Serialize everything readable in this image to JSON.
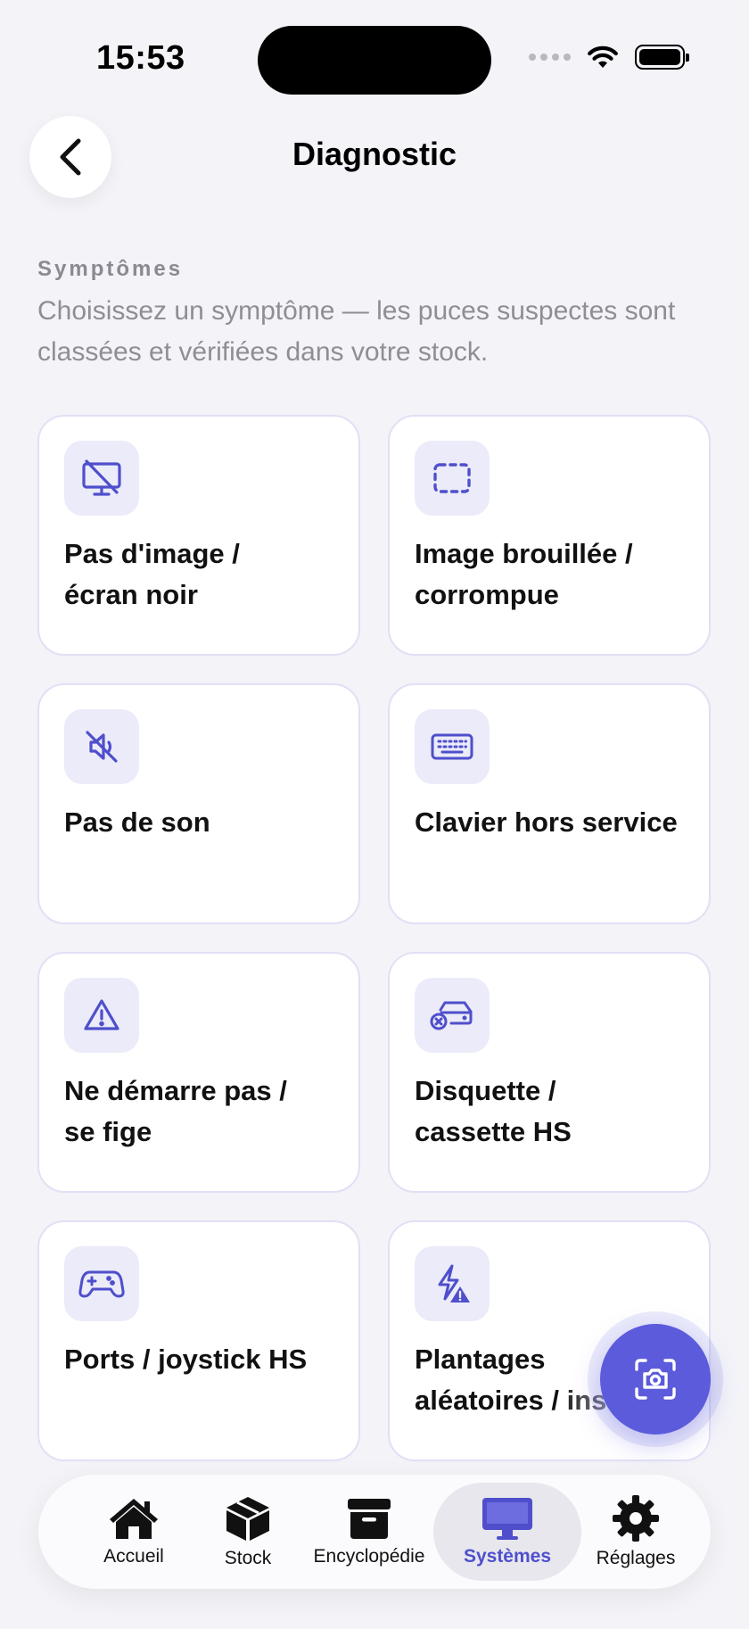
{
  "status": {
    "time": "15:53"
  },
  "header": {
    "title": "Diagnostic"
  },
  "section": {
    "label": "Symptômes",
    "description": "Choisissez un symptôme — les puces suspectes sont classées et vérifiées dans votre stock."
  },
  "symptoms": [
    {
      "title": "Pas d'image /\nécran noir",
      "icon": "display-off-icon"
    },
    {
      "title": "Image brouillée /\ncorrompue",
      "icon": "dashed-rect-icon"
    },
    {
      "title": "Pas de son",
      "icon": "speaker-mute-icon"
    },
    {
      "title": "Clavier hors service",
      "icon": "keyboard-icon"
    },
    {
      "title": "Ne démarre pas /\nse fige",
      "icon": "warning-triangle-icon"
    },
    {
      "title": "Disquette /\ncassette HS",
      "icon": "drive-error-icon"
    },
    {
      "title": "Ports / joystick HS",
      "icon": "gamepad-icon"
    },
    {
      "title": "Plantages\naléatoires / instabl…",
      "icon": "bolt-warning-icon"
    }
  ],
  "tabs": [
    {
      "label": "Accueil",
      "icon": "house-icon",
      "active": false
    },
    {
      "label": "Stock",
      "icon": "cube-icon",
      "active": false
    },
    {
      "label": "Encyclopédie",
      "icon": "archive-box-icon",
      "active": false
    },
    {
      "label": "Systèmes",
      "icon": "desktop-icon",
      "active": true
    },
    {
      "label": "Réglages",
      "icon": "gear-icon",
      "active": false
    }
  ],
  "colors": {
    "accent": "#5b5bdc",
    "icon_bg": "#ebebf9",
    "background": "#f3f3f8"
  }
}
